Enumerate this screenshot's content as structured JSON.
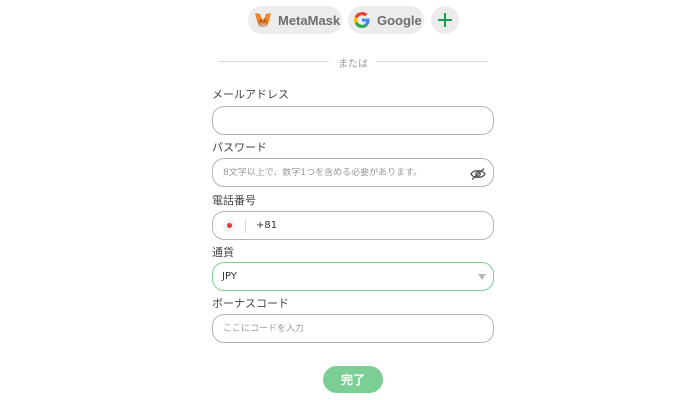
{
  "social": {
    "metamask_label": "MetaMask",
    "google_label": "Google",
    "more_icon": "plus-icon"
  },
  "divider_text": "または",
  "form": {
    "email": {
      "label": "メールアドレス",
      "placeholder": "",
      "value": ""
    },
    "password": {
      "label": "パスワード",
      "placeholder": "8文字以上で、数字1つを含める必要があります。",
      "toggle_icon": "eye-icon"
    },
    "phone": {
      "label": "電話番号",
      "country_flag": "japan-flag-icon",
      "country_code": "+81",
      "value": ""
    },
    "currency": {
      "label": "通貨",
      "selected": "JPY"
    },
    "bonus_code": {
      "label": "ボーナスコード",
      "placeholder": "ここにコードを入力"
    },
    "submit_label": "完了"
  },
  "colors": {
    "accent": "#7ccf94",
    "select_border": "#7ad39a",
    "input_border": "#b5b5b5",
    "plus_icon": "#1e9a4a"
  }
}
